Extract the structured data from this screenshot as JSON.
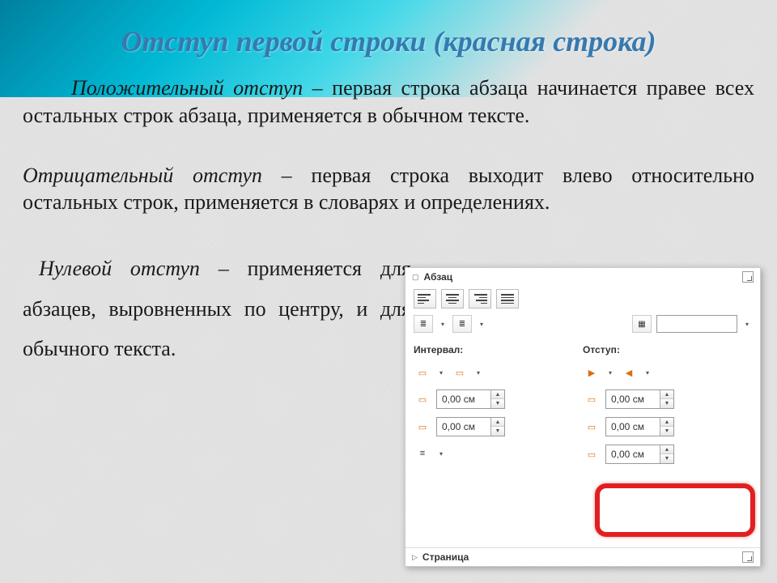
{
  "title": "Отступ первой строки (красная строка)",
  "paragraphs": {
    "p1_term": "Положительный отступ",
    "p1_rest": " – первая строка абзаца начинается правее всех остальных строк абзаца, применяется в обычном тексте.",
    "p2_term": "Отрицательный отступ",
    "p2_rest": " – первая строка выходит влево относительно остальных строк, применяется в словарях и определениях.",
    "p3_term": "Нулевой отступ",
    "p3_rest": " – применяется для абзацев, выровненных по центру, и для обычного текста."
  },
  "panel": {
    "section_paragraph": "Абзац",
    "section_page": "Страница",
    "label_interval": "Интервал:",
    "label_indent": "Отступ:",
    "value_zero": "0,00 см"
  }
}
